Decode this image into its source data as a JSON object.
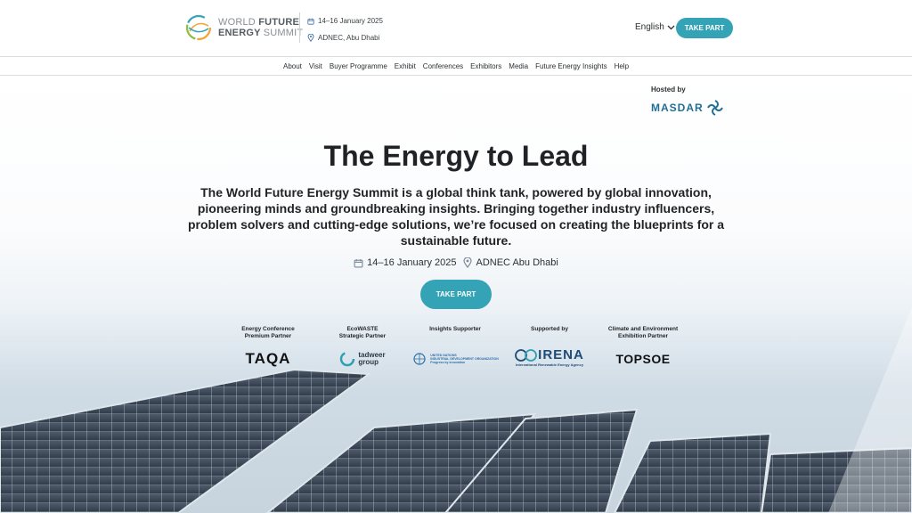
{
  "header": {
    "logo_line1_a": "WORLD ",
    "logo_line1_b": "FUTURE",
    "logo_line2_a": "ENERGY ",
    "logo_line2_b": "SUMMIT",
    "date": "14–16 January 2025",
    "venue": "ADNEC, Abu Dhabi",
    "language": "English",
    "cta": "TAKE PART"
  },
  "nav": {
    "items": [
      "About",
      "Visit",
      "Buyer Programme",
      "Exhibit",
      "Conferences",
      "Exhibitors",
      "Media",
      "Future Energy Insights",
      "Help"
    ]
  },
  "hero": {
    "hosted_by": "Hosted by",
    "host_name": "MASDAR",
    "title": "The Energy to Lead",
    "intro": "The World Future Energy Summit is a global think tank, powered by global innovation, pioneering minds and groundbreaking insights. Bringing together industry influencers, problem solvers and cutting-edge solutions, we’re focused on creating the blueprints for a sustainable future.",
    "date": "14–16 January 2025",
    "venue": "ADNEC Abu Dhabi",
    "cta": "TAKE PART"
  },
  "partners": [
    {
      "title_1": "Energy Conference",
      "title_2": "Premium Partner",
      "logo_text": "TAQA"
    },
    {
      "title_1": "EcoWASTE",
      "title_2": "Strategic Partner",
      "logo_text_1": "tadweer",
      "logo_text_2": "group"
    },
    {
      "title_1": "Insights Supporter",
      "title_2": "",
      "logo_text_1": "UNITED NATIONS",
      "logo_text_2": "INDUSTRIAL DEVELOPMENT ORGANIZATION",
      "logo_text_3": "Progress by innovation"
    },
    {
      "title_1": "Supported by",
      "title_2": "",
      "logo_text_1": "IRENA",
      "logo_text_2": "International Renewable Energy Agency"
    },
    {
      "title_1": "Climate and Environment",
      "title_2": "Exhibition Partner",
      "logo_text": "TOPSOE"
    }
  ],
  "colors": {
    "accent": "#34a3b5",
    "text": "#1f2326",
    "masdar": "#1f6f96"
  },
  "icons": [
    "calendar-icon",
    "location-pin-icon",
    "chevron-down-icon",
    "masdar-swirl-icon",
    "wfes-logo-icon"
  ]
}
